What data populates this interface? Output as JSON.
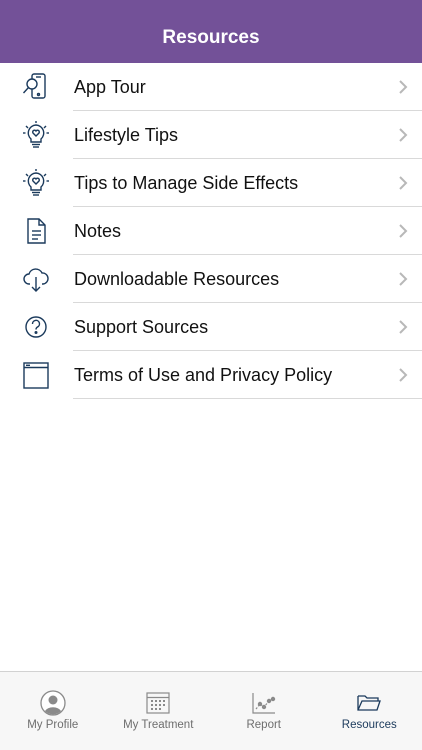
{
  "header": {
    "title": "Resources"
  },
  "items": [
    {
      "label": "App Tour",
      "icon": "phone-search-icon"
    },
    {
      "label": "Lifestyle Tips",
      "icon": "lightbulb-heart-icon"
    },
    {
      "label": "Tips to Manage Side Effects",
      "icon": "lightbulb-heart-icon"
    },
    {
      "label": "Notes",
      "icon": "document-icon"
    },
    {
      "label": "Downloadable Resources",
      "icon": "cloud-download-icon"
    },
    {
      "label": "Support Sources",
      "icon": "question-circle-icon"
    },
    {
      "label": "Terms of Use and Privacy Policy",
      "icon": "browser-window-icon"
    }
  ],
  "tabs": [
    {
      "label": "My Profile",
      "icon": "profile-icon",
      "active": false
    },
    {
      "label": "My Treatment",
      "icon": "calendar-icon",
      "active": false
    },
    {
      "label": "Report",
      "icon": "chart-icon",
      "active": false
    },
    {
      "label": "Resources",
      "icon": "folder-icon",
      "active": true
    }
  ],
  "colors": {
    "header_bg": "#735198",
    "icon_stroke": "#1b3a5c",
    "chevron": "#b8b8b8",
    "tab_active": "#1b3a5c",
    "tab_inactive": "#6e6e6e"
  }
}
